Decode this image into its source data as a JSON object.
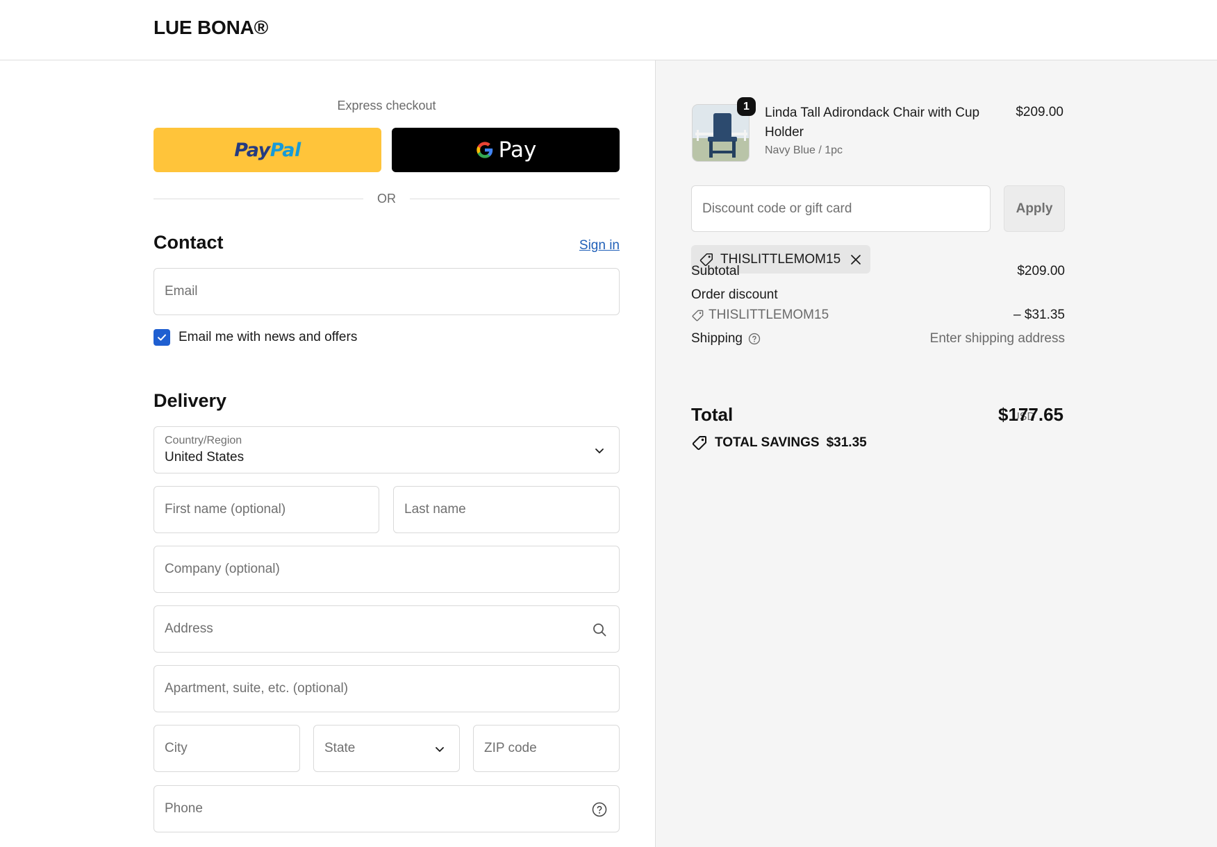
{
  "store": {
    "name": "LUE BONA®"
  },
  "express": {
    "label": "Express checkout",
    "paypal_part1": "Pay",
    "paypal_part2": "Pal",
    "gpay_label": "Pay",
    "or_label": "OR"
  },
  "contact": {
    "title": "Contact",
    "signin": "Sign in",
    "email_placeholder": "Email",
    "newsletter_label": "Email me with news and offers",
    "newsletter_checked": true
  },
  "delivery": {
    "title": "Delivery",
    "country_label": "Country/Region",
    "country_value": "United States",
    "first_name_placeholder": "First name (optional)",
    "last_name_placeholder": "Last name",
    "company_placeholder": "Company (optional)",
    "address_placeholder": "Address",
    "apartment_placeholder": "Apartment, suite, etc. (optional)",
    "city_placeholder": "City",
    "state_placeholder": "State",
    "zip_placeholder": "ZIP code",
    "phone_placeholder": "Phone"
  },
  "summary": {
    "product": {
      "name": "Linda Tall Adirondack Chair with Cup Holder",
      "variant": "Navy Blue / 1pc",
      "price": "$209.00",
      "quantity": "1"
    },
    "discount_placeholder": "Discount code or gift card",
    "apply_label": "Apply",
    "applied_code": "THISLITTLEMOM15",
    "subtotal_label": "Subtotal",
    "subtotal_value": "$209.00",
    "order_discount_label": "Order discount",
    "discount_code": "THISLITTLEMOM15",
    "discount_value": "– $31.35",
    "shipping_label": "Shipping",
    "shipping_value": "Enter shipping address",
    "total_label": "Total",
    "currency": "USD",
    "total_value": "$177.65",
    "savings_label": "TOTAL SAVINGS",
    "savings_value": "$31.35"
  },
  "colors": {
    "paypal_bg": "#ffc43a",
    "link": "#1f5fb8",
    "checkbox": "#1f5fd1",
    "summary_bg": "#f5f5f5"
  }
}
